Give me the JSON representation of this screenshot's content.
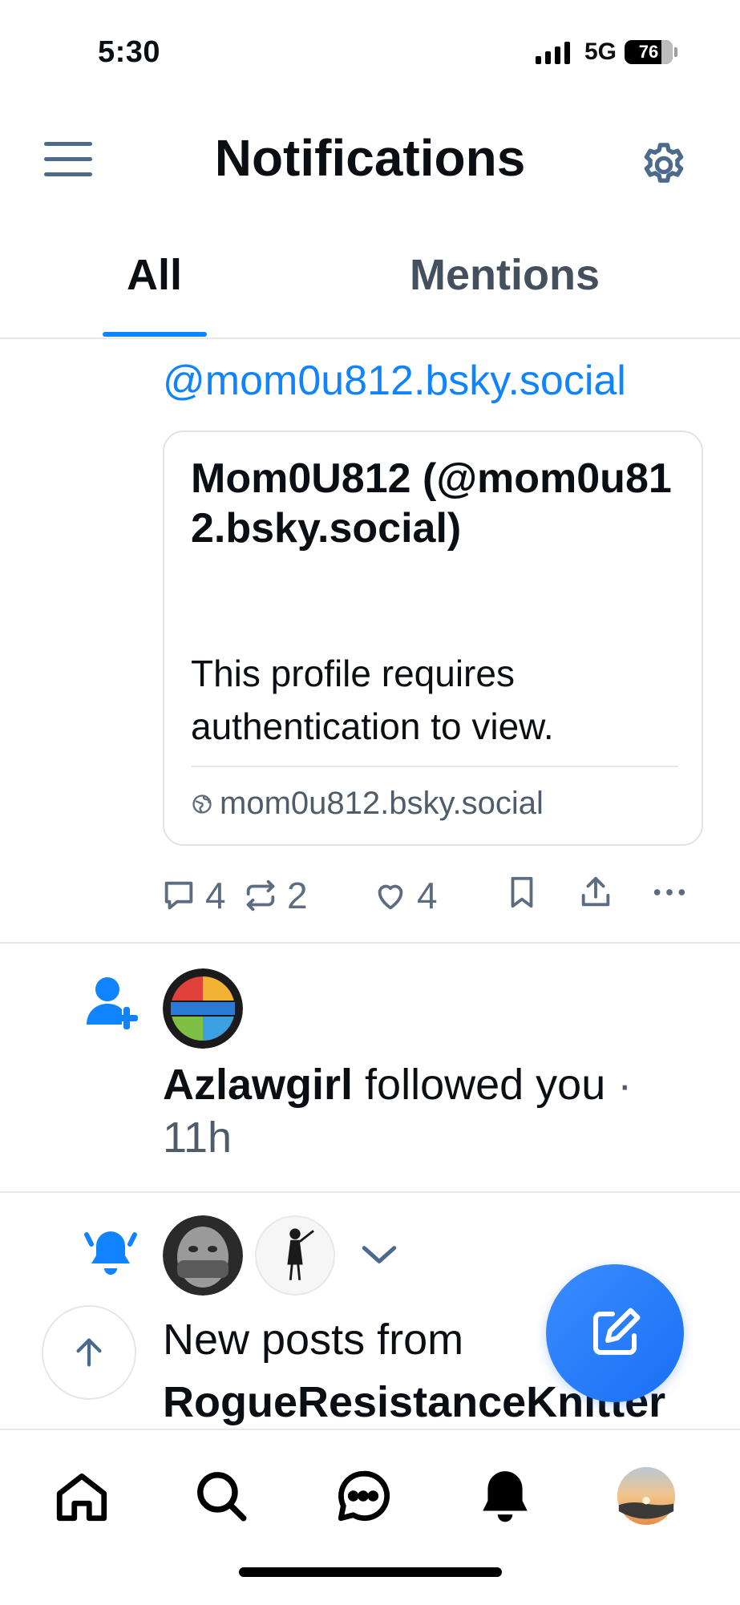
{
  "status_bar": {
    "time": "5:30",
    "network": "5G",
    "battery": "76"
  },
  "header": {
    "title": "Notifications"
  },
  "tabs": [
    {
      "label": "All",
      "active": true
    },
    {
      "label": "Mentions",
      "active": false
    }
  ],
  "post": {
    "mention_link": "@mom0u812.bsky.social",
    "embed": {
      "title": "Mom0U812 (@mom0u812.bsky.social)",
      "description": "This profile requires authentication to view.",
      "domain": "mom0u812.bsky.social"
    },
    "actions": {
      "reply_count": "4",
      "repost_count": "2",
      "like_count": "4"
    }
  },
  "follow_notification": {
    "name": "Azlawgirl",
    "action": " followed you ",
    "separator": "·",
    "time": "11h"
  },
  "new_posts_notification": {
    "line1": "New posts from",
    "author": "RogueResistanceKnitter"
  },
  "colors": {
    "accent": "#1083fe",
    "icon_muted": "#5c6d80",
    "menu_icon": "#4c6a8c"
  },
  "icons": {
    "menu": "hamburger-menu-icon",
    "settings": "gear-icon",
    "globe": "globe-icon",
    "reply": "speech-bubble-icon",
    "repost": "repost-arrows-icon",
    "like": "heart-icon",
    "bookmark": "bookmark-icon",
    "share": "share-icon",
    "more": "ellipsis-icon",
    "follow": "person-add-icon",
    "notify": "ringing-bell-icon",
    "scroll_top": "arrow-up-icon",
    "compose": "compose-icon",
    "nav": [
      "home-icon",
      "search-icon",
      "chat-icon",
      "bell-icon",
      "profile-avatar"
    ]
  }
}
